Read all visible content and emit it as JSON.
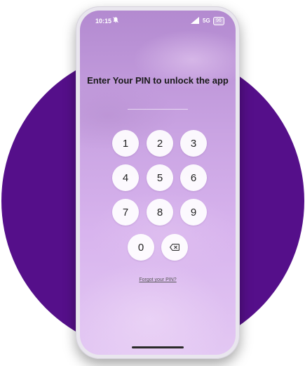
{
  "status_bar": {
    "time": "10:15",
    "network": "5G",
    "battery": "96"
  },
  "pin_screen": {
    "title": "Enter Your PIN to unlock the app",
    "keys": [
      "1",
      "2",
      "3",
      "4",
      "5",
      "6",
      "7",
      "8",
      "9",
      "0"
    ],
    "forgot_link": "Forgot your PIN?"
  },
  "colors": {
    "background_circle": "#550f8a",
    "screen_gradient_top": "#b38ad0",
    "screen_gradient_bottom": "#e3c8f3",
    "key_fill": "#ffffff"
  },
  "icons": {
    "notification": "bell-off-icon",
    "signal": "signal-icon",
    "backspace": "backspace-icon"
  }
}
